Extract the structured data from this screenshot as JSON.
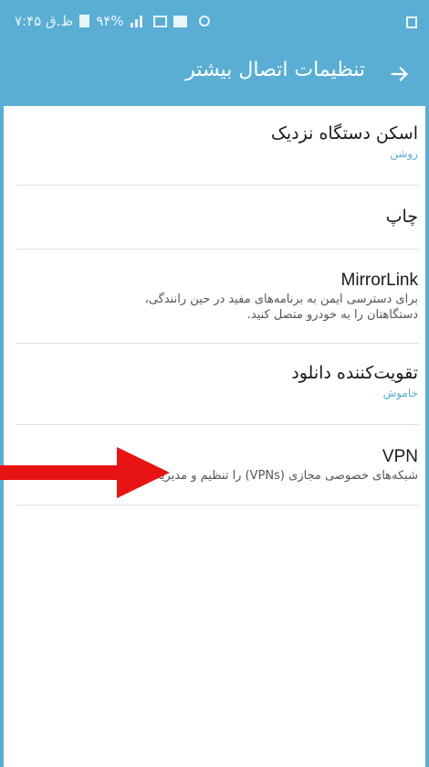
{
  "status_bar": {
    "carrier_time": "ظ.ق ۷:۴۵",
    "battery": "۹۴%",
    "icons": [
      "battery-icon",
      "signal-icon",
      "sim-icon",
      "sim2-icon",
      "alarm-icon",
      "document-icon"
    ]
  },
  "app_bar": {
    "title": "تنظیمات اتصال بیشتر",
    "back_icon": "arrow-right-icon"
  },
  "items": [
    {
      "title": "اسکن دستگاه نزدیک",
      "subtitle": "روشن"
    },
    {
      "title": "چاپ"
    },
    {
      "title": "MirrorLink",
      "description_line1": "برای دسترسی ایمن به برنامه‌های مفید در حین رانندگی،",
      "description_line2": "دستگاهتان را به خودرو متصل کنید."
    },
    {
      "title": "تقویت‌کننده دانلود",
      "subtitle": "خاموش"
    },
    {
      "title": "VPN",
      "description_line1": "شبکه‌های خصوصی مجازی (VPNs) را تنظیم و مدیریت کنید."
    }
  ],
  "colors": {
    "accent": "#5aaed4",
    "annotation_arrow": "#e81414"
  }
}
